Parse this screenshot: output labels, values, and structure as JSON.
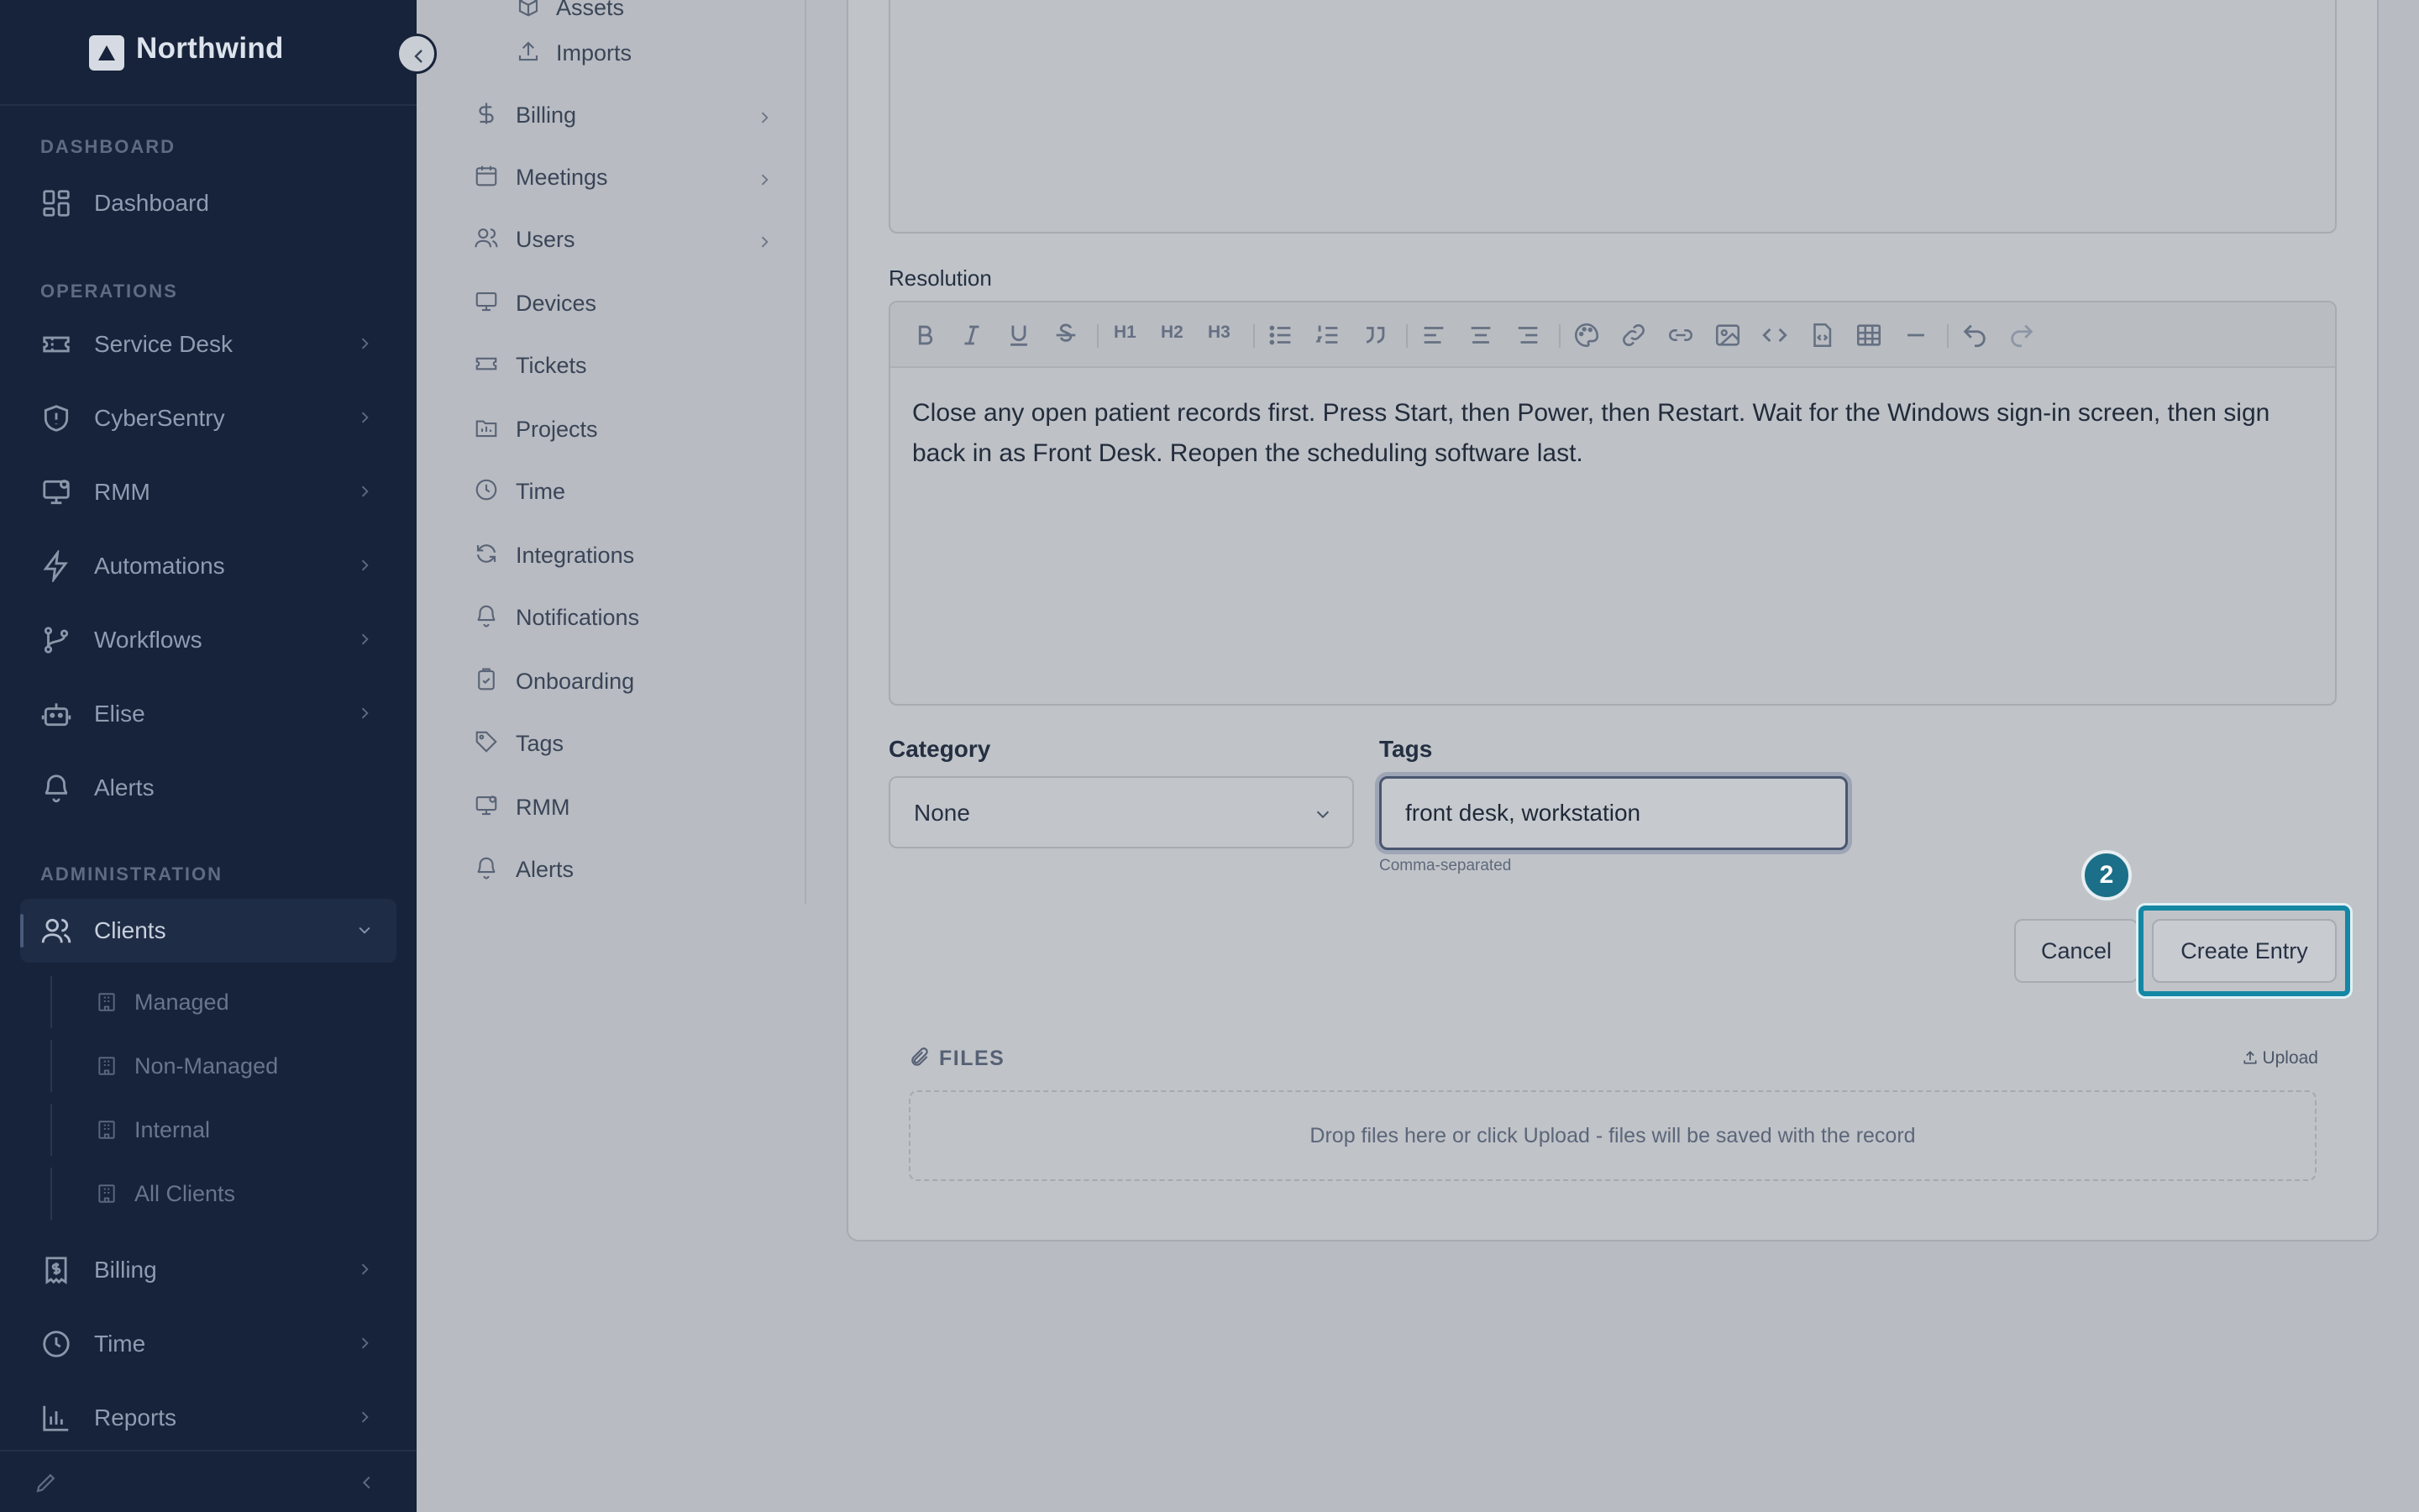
{
  "brand": {
    "name": "Northwind"
  },
  "sidebar": {
    "sections": {
      "dashboard": "DASHBOARD",
      "operations": "OPERATIONS",
      "administration": "ADMINISTRATION"
    },
    "items": {
      "dashboard": "Dashboard",
      "service_desk": "Service Desk",
      "cybersentry": "CyberSentry",
      "rmm": "RMM",
      "automations": "Automations",
      "workflows": "Workflows",
      "elise": "Elise",
      "alerts": "Alerts",
      "clients": "Clients",
      "billing": "Billing",
      "time": "Time",
      "reports": "Reports"
    },
    "clients_children": [
      "Managed",
      "Non-Managed",
      "Internal",
      "All Clients"
    ]
  },
  "subnav": {
    "assets": "Assets",
    "imports": "Imports",
    "billing": "Billing",
    "meetings": "Meetings",
    "users": "Users",
    "devices": "Devices",
    "tickets": "Tickets",
    "projects": "Projects",
    "time": "Time",
    "integrations": "Integrations",
    "notifications": "Notifications",
    "onboarding": "Onboarding",
    "tags": "Tags",
    "rmm": "RMM",
    "alerts": "Alerts"
  },
  "form": {
    "resolution_label": "Resolution",
    "resolution_text": "Close any open patient records first. Press Start, then Power, then Restart. Wait for the Windows sign-in screen, then sign back in as Front Desk. Reopen the scheduling software last.",
    "toolbar_headings": [
      "H1",
      "H2",
      "H3"
    ],
    "category_label": "Category",
    "category_value": "None",
    "tags_label": "Tags",
    "tags_value": "front desk, workstation",
    "tags_hint": "Comma-separated",
    "cancel_label": "Cancel",
    "create_label": "Create Entry",
    "step_badge": "2"
  },
  "files": {
    "title": "FILES",
    "upload_label": "Upload",
    "dropzone_text": "Drop files here or click Upload - files will be saved with the record"
  },
  "colors": {
    "sidebar_bg": "#17233a",
    "highlight": "#1487a4",
    "badge": "#1b6f88",
    "overlay": "#b8bbc1"
  }
}
